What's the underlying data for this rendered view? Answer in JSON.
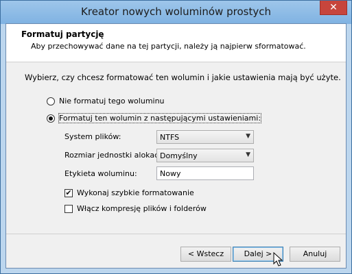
{
  "window": {
    "title": "Kreator nowych woluminów prostych",
    "close_glyph": "✕"
  },
  "header": {
    "title": "Formatuj partycję",
    "subtitle": "Aby przechowywać dane na tej partycji, należy ją najpierw sformatować."
  },
  "description": "Wybierz, czy chcesz formatować ten wolumin i jakie ustawienia mają być użyte.",
  "options": {
    "no_format": "Nie formatuj tego woluminu",
    "format": "Formatuj ten wolumin z następującymi ustawieniami:",
    "selected": "format"
  },
  "settings": {
    "fs_label": "System plików:",
    "fs_value": "NTFS",
    "alloc_label": "Rozmiar jednostki alokacji:",
    "alloc_value": "Domyślny",
    "volume_label_label": "Etykieta woluminu:",
    "volume_label_value": "Nowy"
  },
  "checks": {
    "quick_format": "Wykonaj szybkie formatowanie",
    "quick_format_checked": true,
    "compression": "Włącz kompresję plików i folderów",
    "compression_checked": false
  },
  "buttons": {
    "back": "< Wstecz",
    "next": "Dalej >",
    "cancel": "Anuluj"
  },
  "icons": {
    "dropdown": "chevron-down-icon",
    "cursor": "mouse-pointer-icon"
  }
}
